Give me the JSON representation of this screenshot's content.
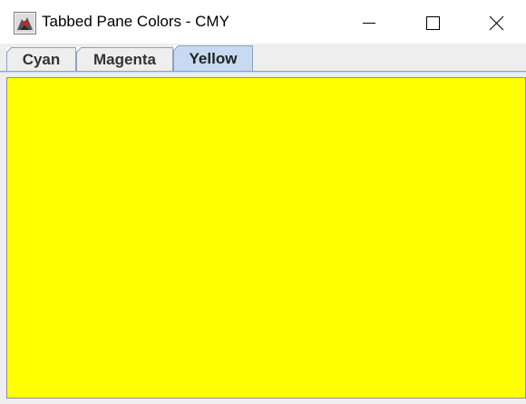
{
  "window": {
    "title": "Tabbed Pane Colors - CMY",
    "icon": "java-duke-icon",
    "controls": {
      "minimize": "minimize-icon",
      "maximize": "maximize-icon",
      "close": "close-icon"
    }
  },
  "tabs": [
    {
      "label": "Cyan",
      "color": "#00ffff",
      "selected": false
    },
    {
      "label": "Magenta",
      "color": "#ff00ff",
      "selected": false
    },
    {
      "label": "Yellow",
      "color": "#ffff00",
      "selected": true
    }
  ],
  "panel": {
    "background": "#ffff00"
  },
  "theme": {
    "selected_tab_bg": "#c7daf2",
    "tab_border": "#8da2c0",
    "chrome_bg": "#eeeeee"
  }
}
